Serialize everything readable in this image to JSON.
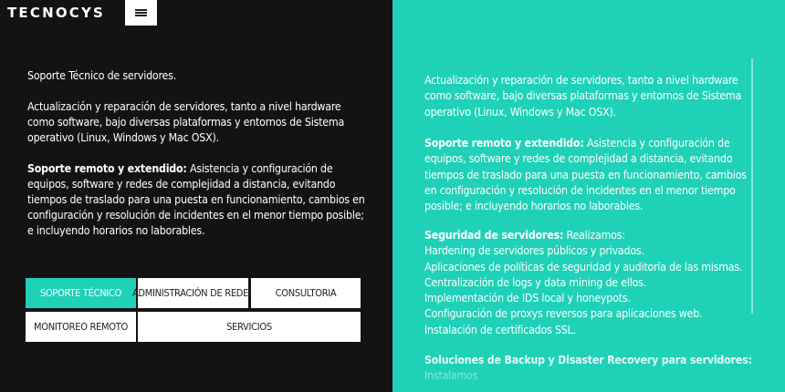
{
  "brand": {
    "logo_text": "TECNOCYS"
  },
  "header": {
    "menu_icon": "hamburger-icon"
  },
  "left_panel": {
    "title": "Soporte Técnico de servidores.",
    "para1": "Actualización y reparación de servidores, tanto a nivel hardware como software, bajo diversas plataformas y entornos de Sistema operativo (Linux, Windows y Mac OSX).",
    "para2_strong": "Soporte remoto y extendido:",
    "para2_text": " Asistencia y configuración de equipos, software y redes de complejidad a distancia, evitando tiempos de traslado para una puesta en funcionamiento, cambios en configuración y resolución de incidentes en el menor tiempo posible; e incluyendo horarios no laborables."
  },
  "tabs": [
    {
      "label": "SOPORTE TÉCNICO",
      "active": true
    },
    {
      "label": "ADMINISTRACIÓN DE REDES",
      "active": false
    },
    {
      "label": "CONSULTORIA",
      "active": false
    },
    {
      "label": "MONITOREO REMOTO",
      "active": false
    },
    {
      "label": "SERVICIOS",
      "active": false
    }
  ],
  "right_panel": {
    "para1": "Actualización y reparación de servidores, tanto a nivel hardware como software, bajo diversas plataformas y entornos de Sistema operativo (Linux, Windows y Mac OSX).",
    "para2_strong": "Soporte remoto y extendido:",
    "para2_text": " Asistencia y configuración de equipos, software y redes de complejidad a distancia, evitando tiempos de traslado para una puesta en funcionamiento, cambios en configuración y resolución de incidentes en el menor tiempo posible; e incluyendo horarios no laborables.",
    "para3_strong": "Seguridad de servidores:",
    "para3_text": " Realizamos:",
    "security_items": [
      "Hardening de servidores públicos y privados.",
      "Aplicaciones de políticas de seguridad y auditoría de las mismas.",
      "Centralización de logs y data mining de ellos.",
      "Implementación de IDS local y honeypots.",
      "Configuración de proxys reversos para aplicaciones web.",
      "Instalación de certificados SSL."
    ],
    "para4_strong": "Soluciones de Backup y Disaster Recovery para servidores:",
    "para4_text": " Instalamos"
  },
  "colors": {
    "dark_bg": "#131313",
    "accent": "#1fd1b7",
    "text_light": "#ffffff",
    "text_dark": "#222222"
  }
}
